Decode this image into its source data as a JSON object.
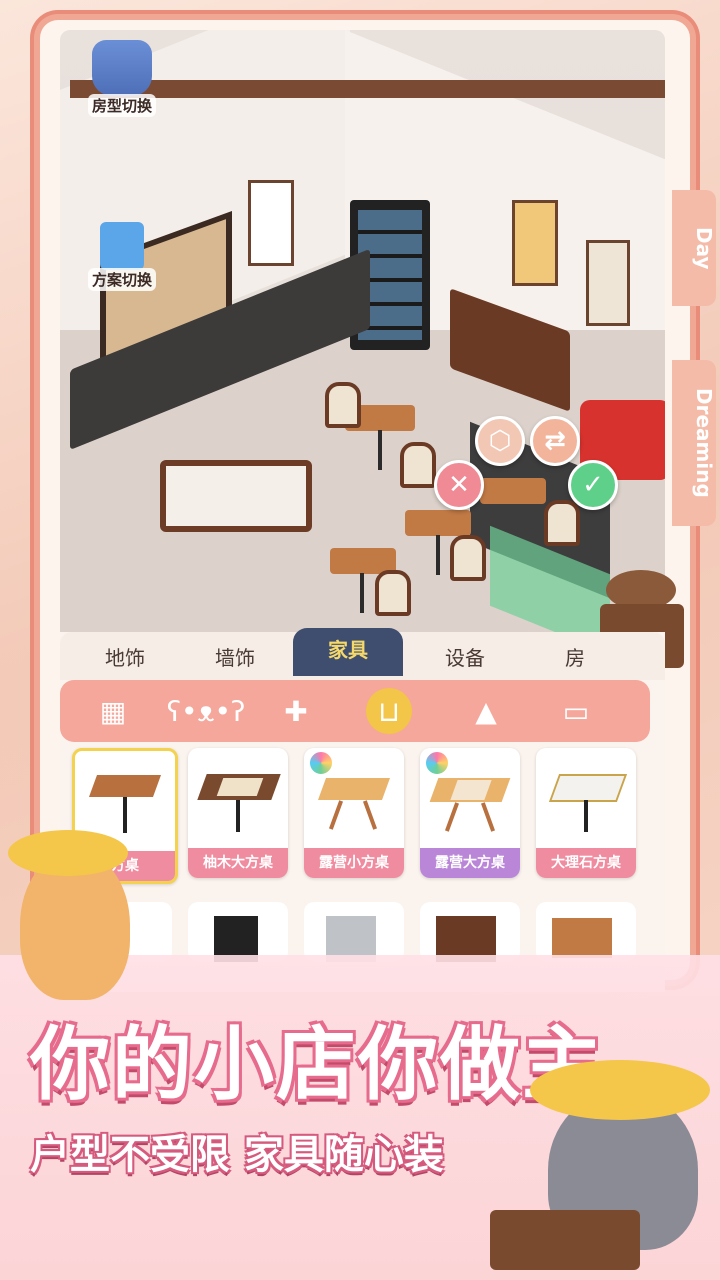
{
  "side_buttons": {
    "room_switch": "房型切换",
    "plan_switch": "方案切换"
  },
  "edge_tabs": {
    "day": "Day",
    "dreaming": "Dreaming"
  },
  "tabs": [
    "地饰",
    "墙饰",
    "家具",
    "设备",
    "房"
  ],
  "active_tab_index": 2,
  "category_icons": [
    "grid-icon",
    "bear-icon",
    "gamepad-icon",
    "armchair-icon",
    "lamp-icon",
    "tv-icon"
  ],
  "active_category_index": 3,
  "items": [
    {
      "name": "方桌",
      "color": "#f08ca0",
      "selected": true,
      "new_badge": false
    },
    {
      "name": "柚木大方桌",
      "color": "#f08ca0",
      "selected": false,
      "new_badge": false
    },
    {
      "name": "露营小方桌",
      "color": "#f08ca0",
      "selected": false,
      "new_badge": true
    },
    {
      "name": "露营大方桌",
      "color": "#b986d8",
      "selected": false,
      "new_badge": true
    },
    {
      "name": "大理石方桌",
      "color": "#f08ca0",
      "selected": false,
      "new_badge": false
    }
  ],
  "banner": {
    "headline": "你的小店你做主",
    "subline": "户型不受限 家具随心装"
  },
  "colors": {
    "accent_pink": "#f4a79a",
    "tab_active_bg": "#3f4d6f",
    "tab_active_text": "#f5d86a",
    "cancel": "#f08a94",
    "confirm": "#5fd08a",
    "rotate": "#f2b49a"
  }
}
